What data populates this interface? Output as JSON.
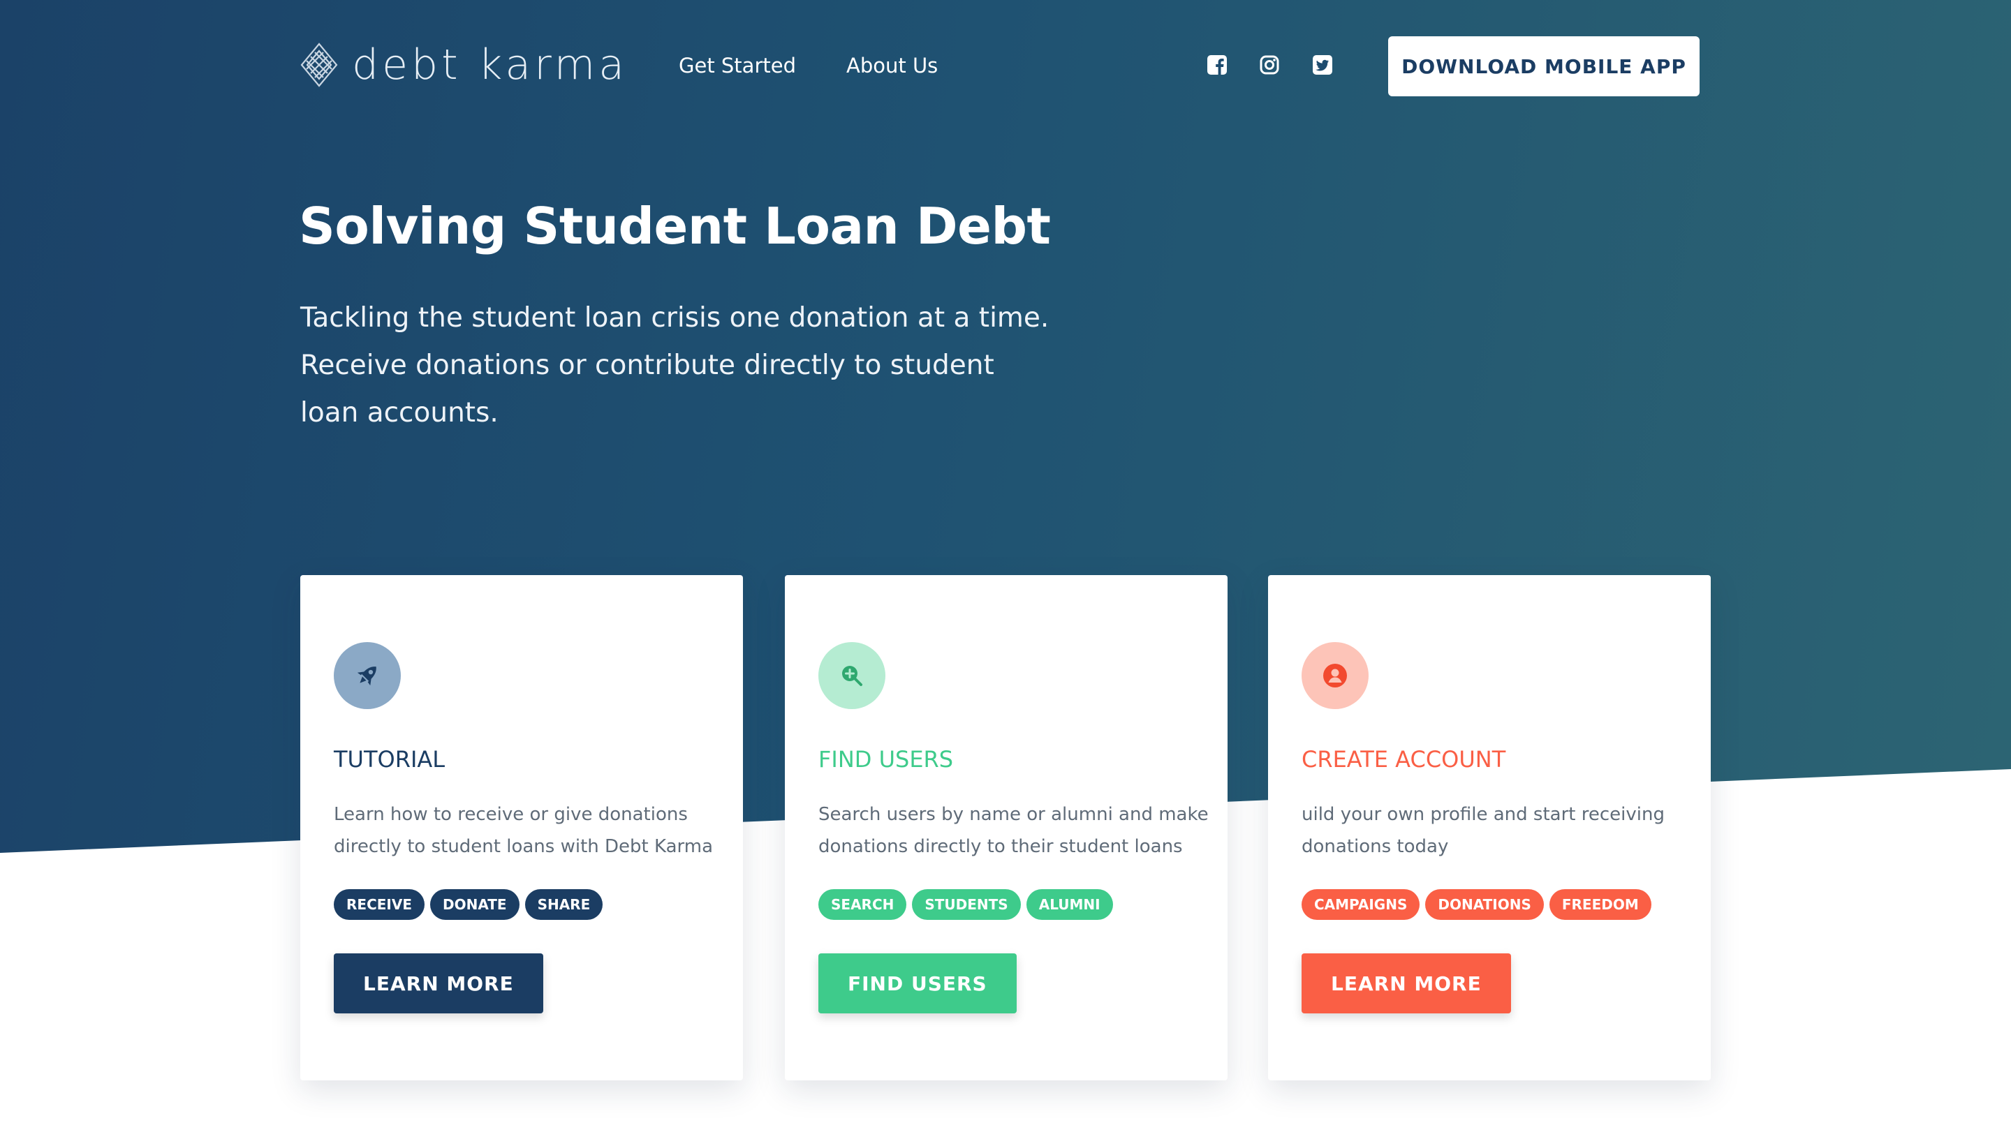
{
  "colors": {
    "navy": "#1b3d63",
    "green": "#3ecb8b",
    "orange": "#fa5f45",
    "hero_start": "#1b4268",
    "hero_end": "#2d6573"
  },
  "header": {
    "logo_text": "debt karma",
    "logo_icon": "endless-knot-icon",
    "nav": [
      {
        "label": "Get Started"
      },
      {
        "label": "About Us"
      }
    ],
    "social": [
      "facebook-icon",
      "instagram-icon",
      "twitter-icon"
    ],
    "download_label": "DOWNLOAD MOBILE APP"
  },
  "hero": {
    "title": "Solving Student Loan Debt",
    "subtitle_lines": [
      "Tackling the student loan crisis one donation at a time.",
      "Receive donations or contribute directly to student",
      "loan accounts."
    ]
  },
  "cards": [
    {
      "icon": "rocket-icon",
      "title": "TUTORIAL",
      "desc_lines": [
        "Learn how to receive or give donations",
        "directly to student loans with Debt Karma"
      ],
      "tags": [
        "RECEIVE",
        "DONATE",
        "SHARE"
      ],
      "button": "LEARN MORE",
      "color": "#1b3d63",
      "icon_bg": "#8ba9c6"
    },
    {
      "icon": "search-plus-icon",
      "title": "FIND USERS",
      "desc_lines": [
        "Search users by name or alumni and make",
        "donations directly to their student loans"
      ],
      "tags": [
        "SEARCH",
        "STUDENTS",
        "ALUMNI"
      ],
      "button": "FIND USERS",
      "color": "#3ecb8b",
      "icon_bg": "#b5ecd2"
    },
    {
      "icon": "user-circle-icon",
      "title": "CREATE ACCOUNT",
      "desc_lines": [
        "uild your own profile and start receiving",
        "donations today"
      ],
      "tags": [
        "CAMPAIGNS",
        "DONATIONS",
        "FREEDOM"
      ],
      "button": "LEARN MORE",
      "color": "#fa5f45",
      "icon_bg": "#fdc4b8"
    }
  ]
}
